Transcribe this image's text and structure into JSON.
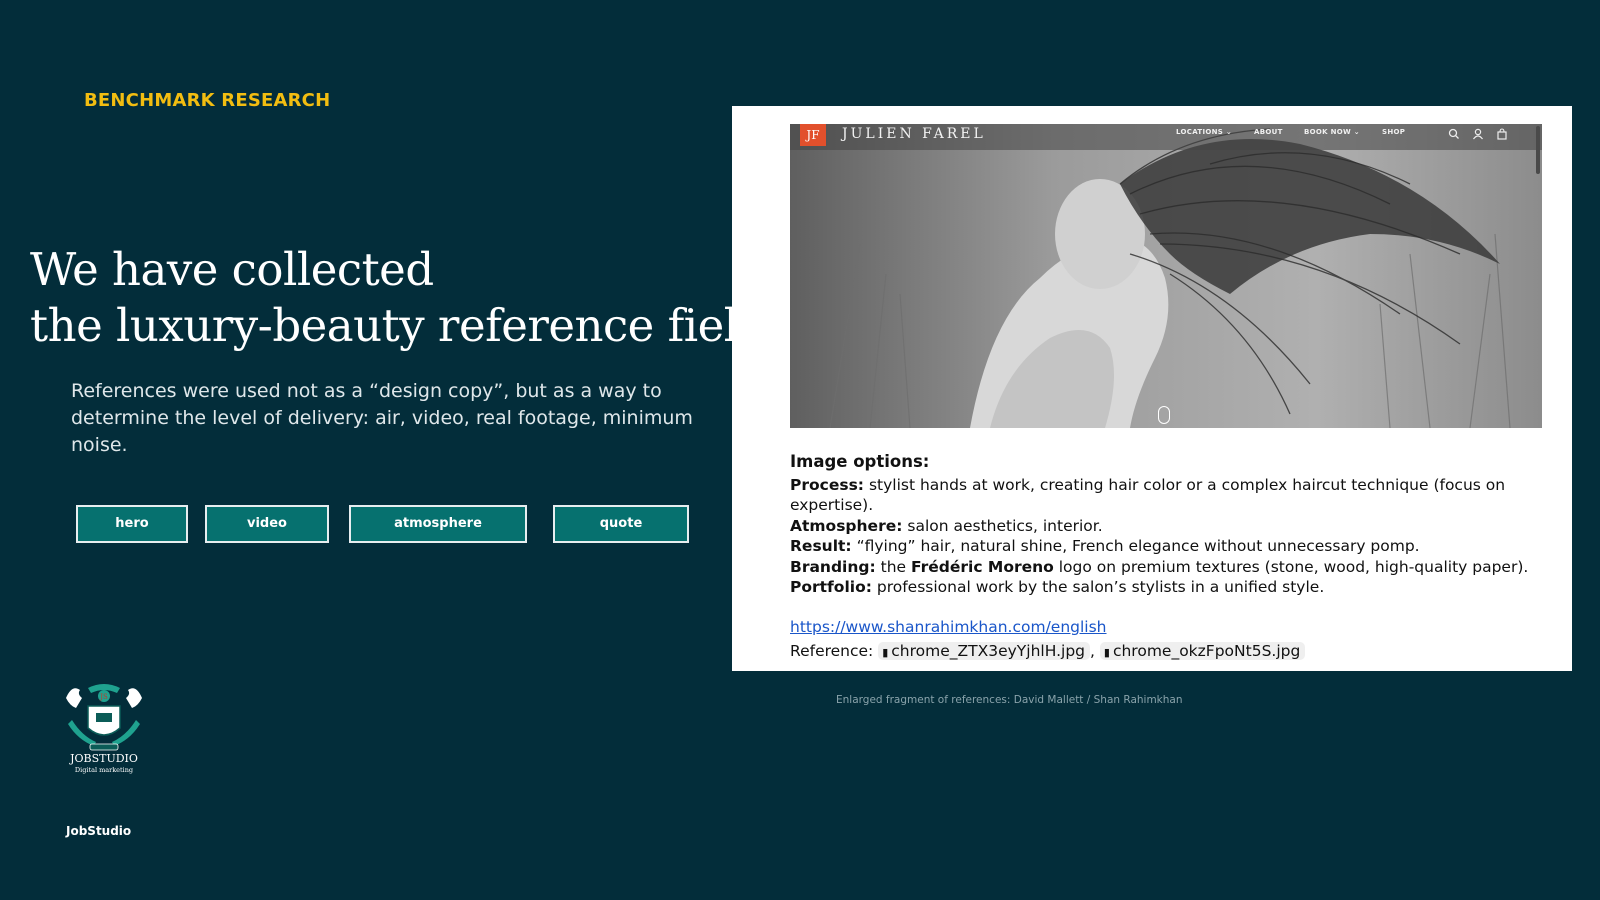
{
  "slide": {
    "eyebrow": "BENCHMARK RESEARCH",
    "headline_line1": "We have collected",
    "headline_line2": "the luxury-beauty reference field",
    "lead": "References were used not as a “design copy”, but as a way to determine the level of delivery: air, video, real footage, minimum noise.",
    "pills": [
      "hero",
      "video",
      "atmosphere",
      "quote"
    ],
    "brand_label": "JobStudio",
    "caption": "Enlarged fragment of references: David Mallett / Shan Rahimkhan"
  },
  "logo": {
    "badge": "JS",
    "name": "JOBSTUDIO",
    "tagline": "Digital marketing"
  },
  "reference_site": {
    "logo_mark": "JF",
    "name": "JULIEN FAREL",
    "nav": [
      "LOCATIONS ⌄",
      "ABOUT",
      "BOOK NOW ⌄",
      "SHOP"
    ],
    "icons": [
      "search-icon",
      "account-icon",
      "bag-icon"
    ]
  },
  "notes": {
    "heading": "Image options:",
    "items": [
      {
        "label": "Process:",
        "text": " stylist hands at work, creating hair color or a complex haircut technique (focus on expertise)."
      },
      {
        "label": "Atmosphere:",
        "text": " salon aesthetics, interior."
      },
      {
        "label": "Result:",
        "text": " “flying” hair, natural shine, French elegance without unnecessary pomp."
      },
      {
        "label": "Branding:",
        "text_before": " the ",
        "strong": "Frédéric Moreno",
        "text_after": " logo on premium textures (stone, wood, high-quality paper)."
      },
      {
        "label": "Portfolio:",
        "text": " professional work by the salon’s stylists in a unified style."
      }
    ],
    "link": "https://www.shanrahimkhan.com/english",
    "reference_label": "Reference:",
    "files": [
      "chrome_ZTX3eyYjhlH.jpg",
      "chrome_okzFpoNt5S.jpg"
    ],
    "separator": ","
  },
  "colors": {
    "background": "#032d3a",
    "accent": "#f2bd11",
    "pill_fill": "#06716f",
    "link": "#1a56c9"
  }
}
